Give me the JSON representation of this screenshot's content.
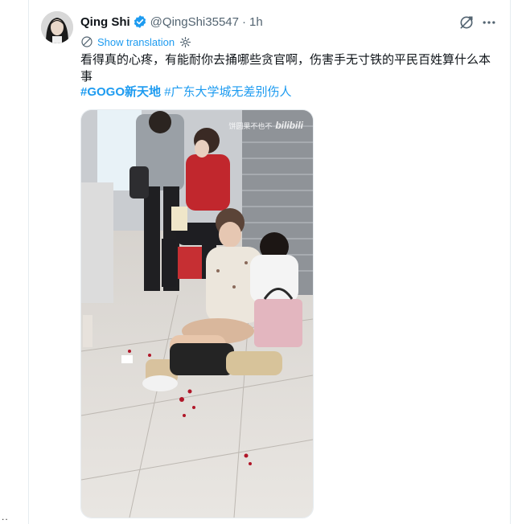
{
  "author": {
    "name": "Qing Shi",
    "handle": "@QingShi35547",
    "separator": "·",
    "time": "1h"
  },
  "translation": {
    "label": "Show translation"
  },
  "tweet": {
    "text": "看得真的心疼，有能耐你去捅哪些贪官啊，伤害手无寸铁的平民百姓算什么本事",
    "hashtags": [
      "#GOGO新天地",
      "#广东大学城无差别伤人"
    ]
  },
  "media": {
    "watermark_text": "饼圆果不也不",
    "watermark_brand": "bilibili"
  },
  "overflow": "..",
  "icons": {
    "verified": "verified-badge-icon",
    "grok": "grok-icon",
    "more": "more-options-icon",
    "translate": "translate-icon",
    "settings": "gear-icon"
  },
  "colors": {
    "accent": "#1d9bf0",
    "text": "#0f1419",
    "muted": "#536471"
  }
}
